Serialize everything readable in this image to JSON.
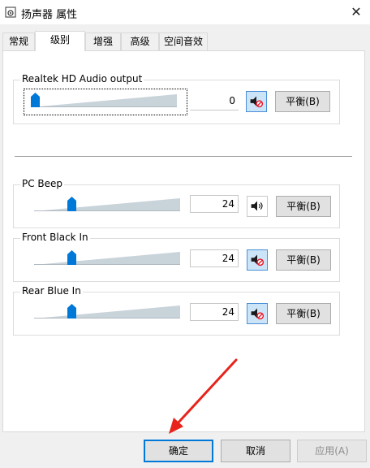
{
  "window": {
    "title": "扬声器 属性",
    "close": "✕"
  },
  "tabs": [
    "常规",
    "级别",
    "增强",
    "高级",
    "空间音效"
  ],
  "active_tab": "级别",
  "devices": [
    {
      "name": "Realtek HD Audio output",
      "value": "0",
      "level": 0,
      "muted": true,
      "balance_label": "平衡(B)"
    },
    {
      "name": "PC Beep",
      "value": "24",
      "level": 24,
      "muted": false,
      "balance_label": "平衡(B)"
    },
    {
      "name": "Front Black In",
      "value": "24",
      "level": 24,
      "muted": true,
      "balance_label": "平衡(B)"
    },
    {
      "name": "Rear Blue In",
      "value": "24",
      "level": 24,
      "muted": true,
      "balance_label": "平衡(B)"
    }
  ],
  "footer": {
    "ok": "确定",
    "cancel": "取消",
    "apply": "应用(A)"
  },
  "colors": {
    "accent": "#0078d7",
    "arrow": "#e8231b",
    "mute_bg": "#cce4f7"
  }
}
